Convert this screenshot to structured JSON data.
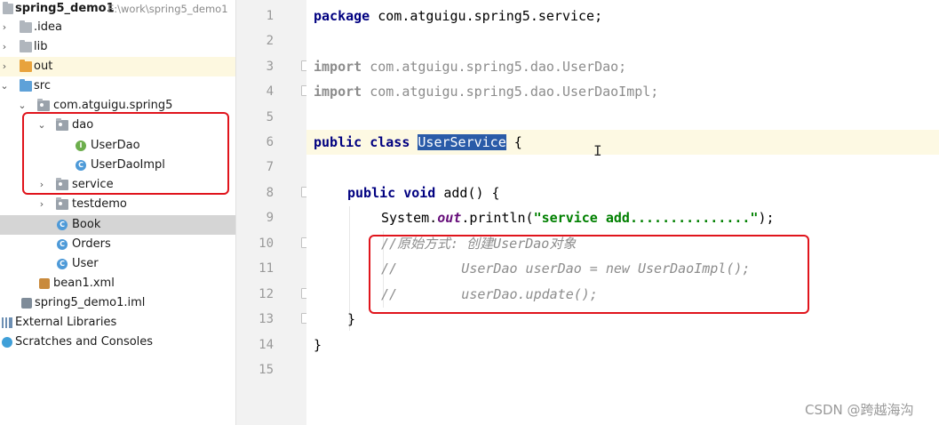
{
  "tree": {
    "project_name": "spring5_demo1",
    "project_path": "E:\\work\\spring5_demo1",
    "items": [
      {
        "label": ".idea"
      },
      {
        "label": "lib"
      },
      {
        "label": "out"
      },
      {
        "label": "src"
      },
      {
        "label": "com.atguigu.spring5"
      },
      {
        "label": "dao"
      },
      {
        "label": "UserDao",
        "badge": "I"
      },
      {
        "label": "UserDaoImpl",
        "badge": "C"
      },
      {
        "label": "service"
      },
      {
        "label": "testdemo"
      },
      {
        "label": "Book",
        "badge": "C"
      },
      {
        "label": "Orders",
        "badge": "C"
      },
      {
        "label": "User",
        "badge": "C"
      },
      {
        "label": "bean1.xml"
      },
      {
        "label": "spring5_demo1.iml"
      },
      {
        "label": "External Libraries"
      },
      {
        "label": "Scratches and Consoles"
      }
    ],
    "arrows": {
      "collapsed": "›",
      "expanded": "⌄"
    }
  },
  "editor": {
    "line_numbers": [
      "1",
      "2",
      "3",
      "4",
      "5",
      "6",
      "7",
      "8",
      "9",
      "10",
      "11",
      "12",
      "13",
      "14",
      "15"
    ],
    "lines": {
      "l1_kw": "package",
      "l1_rest": " com.atguigu.spring5.service;",
      "l3_kw": "import",
      "l3_rest": " com.atguigu.spring5.dao.UserDao;",
      "l4_kw": "import",
      "l4_rest": " com.atguigu.spring5.dao.UserDaoImpl;",
      "l6_kw": "public class",
      "l6_name": "UserService",
      "l6_rest": " {",
      "l8_kw": "public void",
      "l8_rest": " add() {",
      "l9_a": "System.",
      "l9_out": "out",
      "l9_b": ".println(",
      "l9_str": "\"service add...............\"",
      "l9_c": ");",
      "l10": "//原始方式: 创建UserDao对象",
      "l11": "//        UserDao userDao = new UserDaoImpl();",
      "l12": "//        userDao.update();",
      "l13": "}",
      "l14": "}"
    },
    "cursor_glyph": "I"
  },
  "colors": {
    "selection": "#2a5ba8",
    "annotation_box": "#e0141c",
    "current_line": "#fdf9e3"
  },
  "watermark": "CSDN @跨越海沟"
}
